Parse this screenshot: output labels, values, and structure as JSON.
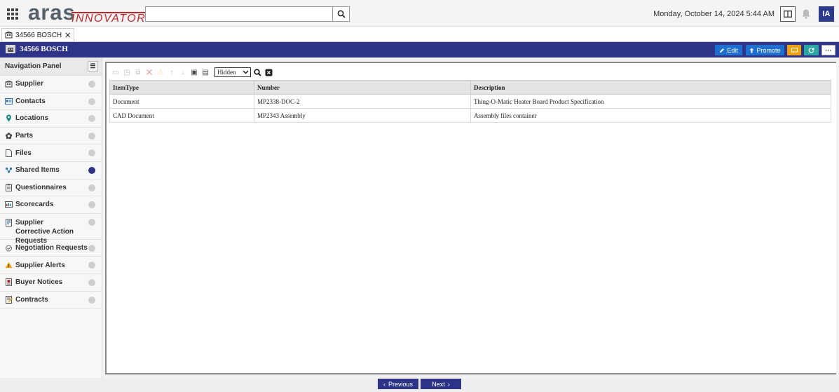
{
  "header": {
    "logo_main": "aras",
    "logo_sub": "INNOVATOR",
    "search": {
      "value": "",
      "placeholder": ""
    },
    "datetime": "Monday, October 14, 2024 5:44 AM",
    "user_initials": "IA"
  },
  "tab": {
    "label": "34566 BOSCH"
  },
  "item": {
    "title": "34566 BOSCH",
    "actions": {
      "edit": "Edit",
      "promote": "Promote"
    }
  },
  "nav": {
    "header": "Navigation Panel",
    "items": [
      {
        "label": "Supplier",
        "icon": "building-icon",
        "active": false
      },
      {
        "label": "Contacts",
        "icon": "contact-card-icon",
        "active": false
      },
      {
        "label": "Locations",
        "icon": "location-pin-icon",
        "active": false
      },
      {
        "label": "Parts",
        "icon": "gear-icon",
        "active": false
      },
      {
        "label": "Files",
        "icon": "file-icon",
        "active": false
      },
      {
        "label": "Shared Items",
        "icon": "shared-icon",
        "active": true
      },
      {
        "label": "Questionnaires",
        "icon": "clipboard-icon",
        "active": false
      },
      {
        "label": "Scorecards",
        "icon": "scorecard-icon",
        "active": false
      },
      {
        "label": "Supplier Corrective Action Requests",
        "icon": "request-icon",
        "active": false
      },
      {
        "label": "Negotiation Requests",
        "icon": "negotiation-icon",
        "active": false
      },
      {
        "label": "Supplier Alerts",
        "icon": "alert-icon",
        "active": false
      },
      {
        "label": "Buyer Notices",
        "icon": "notice-icon",
        "active": false
      },
      {
        "label": "Contracts",
        "icon": "contract-icon",
        "active": false
      }
    ]
  },
  "grid": {
    "filter_value": "Hidden",
    "columns": [
      "ItemType",
      "Number",
      "Description"
    ],
    "rows": [
      [
        "Document",
        "MP2338-DOC-2",
        "Thing-O-Matic Heater Board Product Specification"
      ],
      [
        "CAD Document",
        "MP2343 Assembly",
        "Assembly files container"
      ]
    ]
  },
  "footer": {
    "previous": "Previous",
    "next": "Next"
  },
  "colors": {
    "brand": "#2e3589",
    "accent_blue": "#1f6fd1",
    "warning": "#f0a20b",
    "teal": "#2aa7a1"
  }
}
